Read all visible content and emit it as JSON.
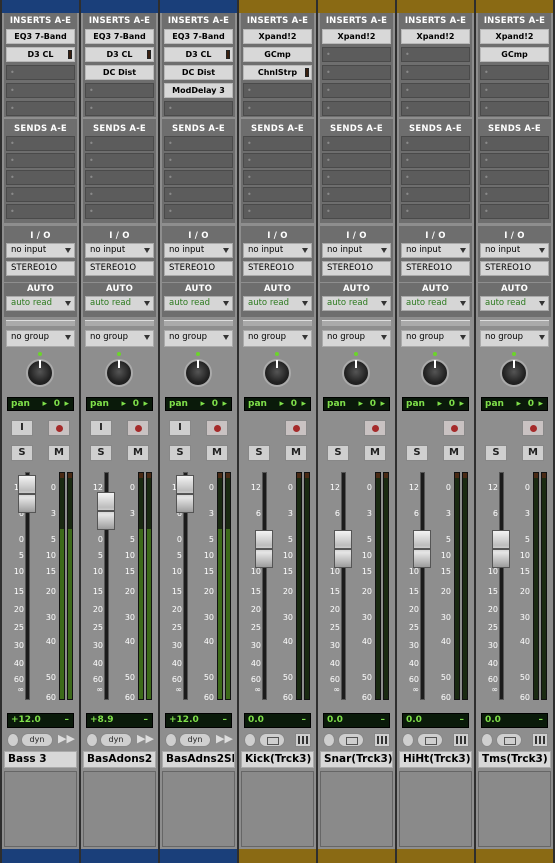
{
  "headers": {
    "inserts": "INSERTS A-E",
    "sends": "SENDS A-E",
    "io": "I / O",
    "auto": "AUTO"
  },
  "colors": {
    "blue_band": "#1a3f7a",
    "orange_band": "#8a6a14",
    "display_green": "#7fe04a",
    "auto_text": "#2c7a1e"
  },
  "scale_left": [
    "12",
    "6",
    "0",
    "5",
    "10",
    "15",
    "20",
    "25",
    "30",
    "40",
    "60",
    "∞"
  ],
  "scale_meter": [
    "0",
    "3",
    "5",
    "10",
    "15",
    "20",
    "30",
    "40",
    "50",
    "60"
  ],
  "tracks": [
    {
      "name": "Bass 3",
      "band": "blue",
      "inserts": [
        "EQ3 7-Band",
        "D3 CL",
        "",
        "",
        ""
      ],
      "input": "no input",
      "output": "STEREO1O",
      "auto": "auto read",
      "group": "no group",
      "pan": "pan",
      "pan_value": "0",
      "rec": true,
      "input_mon": true,
      "volume": "+12.0",
      "vol_fraction": 0.97,
      "dyn_label": "dyn",
      "type": "aux"
    },
    {
      "name": "BasAdons2",
      "band": "blue",
      "inserts": [
        "EQ3 7-Band",
        "D3 CL",
        "DC Dist",
        "",
        ""
      ],
      "input": "no input",
      "output": "STEREO1O",
      "auto": "auto read",
      "group": "no group",
      "pan": "pan",
      "pan_value": "0",
      "rec": true,
      "input_mon": true,
      "volume": "+8.9",
      "vol_fraction": 0.9,
      "dyn_label": "dyn",
      "type": "aux"
    },
    {
      "name": "BasAdns2Sl",
      "band": "blue",
      "inserts": [
        "EQ3 7-Band",
        "D3 CL",
        "DC Dist",
        "ModDelay 3",
        ""
      ],
      "input": "no input",
      "output": "STEREO1O",
      "auto": "auto read",
      "group": "no group",
      "pan": "pan",
      "pan_value": "0",
      "rec": true,
      "input_mon": true,
      "volume": "+12.0",
      "vol_fraction": 0.97,
      "dyn_label": "dyn",
      "type": "aux"
    },
    {
      "name": "Kick(Trck3)",
      "band": "orange",
      "inserts": [
        "Xpand!2",
        "GCmp",
        "ChnlStrp",
        "",
        ""
      ],
      "input": "no input",
      "output": "STEREO1O",
      "auto": "auto read",
      "group": "no group",
      "pan": "pan",
      "pan_value": "0",
      "rec": true,
      "input_mon": false,
      "volume": "0.0",
      "vol_fraction": 0.75,
      "dyn_label": "",
      "type": "inst"
    },
    {
      "name": "Snar(Trck3)",
      "band": "orange",
      "inserts": [
        "Xpand!2",
        "",
        "",
        "",
        ""
      ],
      "input": "no input",
      "output": "STEREO1O",
      "auto": "auto read",
      "group": "no group",
      "pan": "pan",
      "pan_value": "0",
      "rec": true,
      "input_mon": false,
      "volume": "0.0",
      "vol_fraction": 0.75,
      "dyn_label": "",
      "type": "inst"
    },
    {
      "name": "HiHt(Trck3)",
      "band": "orange",
      "inserts": [
        "Xpand!2",
        "",
        "",
        "",
        ""
      ],
      "input": "no input",
      "output": "STEREO1O",
      "auto": "auto read",
      "group": "no group",
      "pan": "pan",
      "pan_value": "0",
      "rec": true,
      "input_mon": false,
      "volume": "0.0",
      "vol_fraction": 0.75,
      "dyn_label": "",
      "type": "inst"
    },
    {
      "name": "Tms(Trck3)",
      "band": "orange",
      "inserts": [
        "Xpand!2",
        "GCmp",
        "",
        "",
        ""
      ],
      "input": "no input",
      "output": "STEREO1O",
      "auto": "auto read",
      "group": "no group",
      "pan": "pan",
      "pan_value": "0",
      "rec": true,
      "input_mon": false,
      "volume": "0.0",
      "vol_fraction": 0.75,
      "dyn_label": "",
      "type": "inst"
    }
  ]
}
